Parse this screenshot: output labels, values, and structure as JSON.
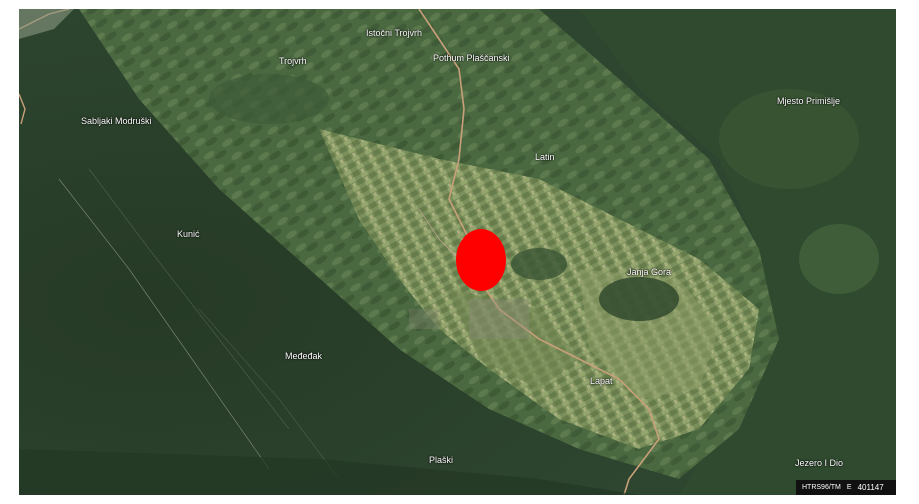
{
  "places": [
    {
      "id": "istocni-trojvrh",
      "name": "Istočni Trojvrh"
    },
    {
      "id": "pothum-plascanski",
      "name": "Pothum Plaščanski"
    },
    {
      "id": "trojvrh",
      "name": "Trojvrh"
    },
    {
      "id": "mjesto-primislje",
      "name": "Mjesto Primišlje"
    },
    {
      "id": "sabljaki-modruski",
      "name": "Sabljaki Modruški"
    },
    {
      "id": "latin",
      "name": "Latin"
    },
    {
      "id": "kunic",
      "name": "Kunić"
    },
    {
      "id": "janja-gora",
      "name": "Janja Gora"
    },
    {
      "id": "mededak",
      "name": "Međeđak"
    },
    {
      "id": "lapat",
      "name": "Lapat"
    },
    {
      "id": "plaski",
      "name": "Plaški"
    },
    {
      "id": "jezero-i-dio",
      "name": "Jezero I Dio"
    }
  ],
  "coordinates": {
    "system": "HTRS96/TM",
    "axis": "E",
    "value": "401147"
  },
  "colors": {
    "marker": "#ff0000",
    "label_text": "#ffffff",
    "road": "#c9a07a"
  },
  "icons": {
    "location_marker": "red-ellipse-marker-icon"
  }
}
